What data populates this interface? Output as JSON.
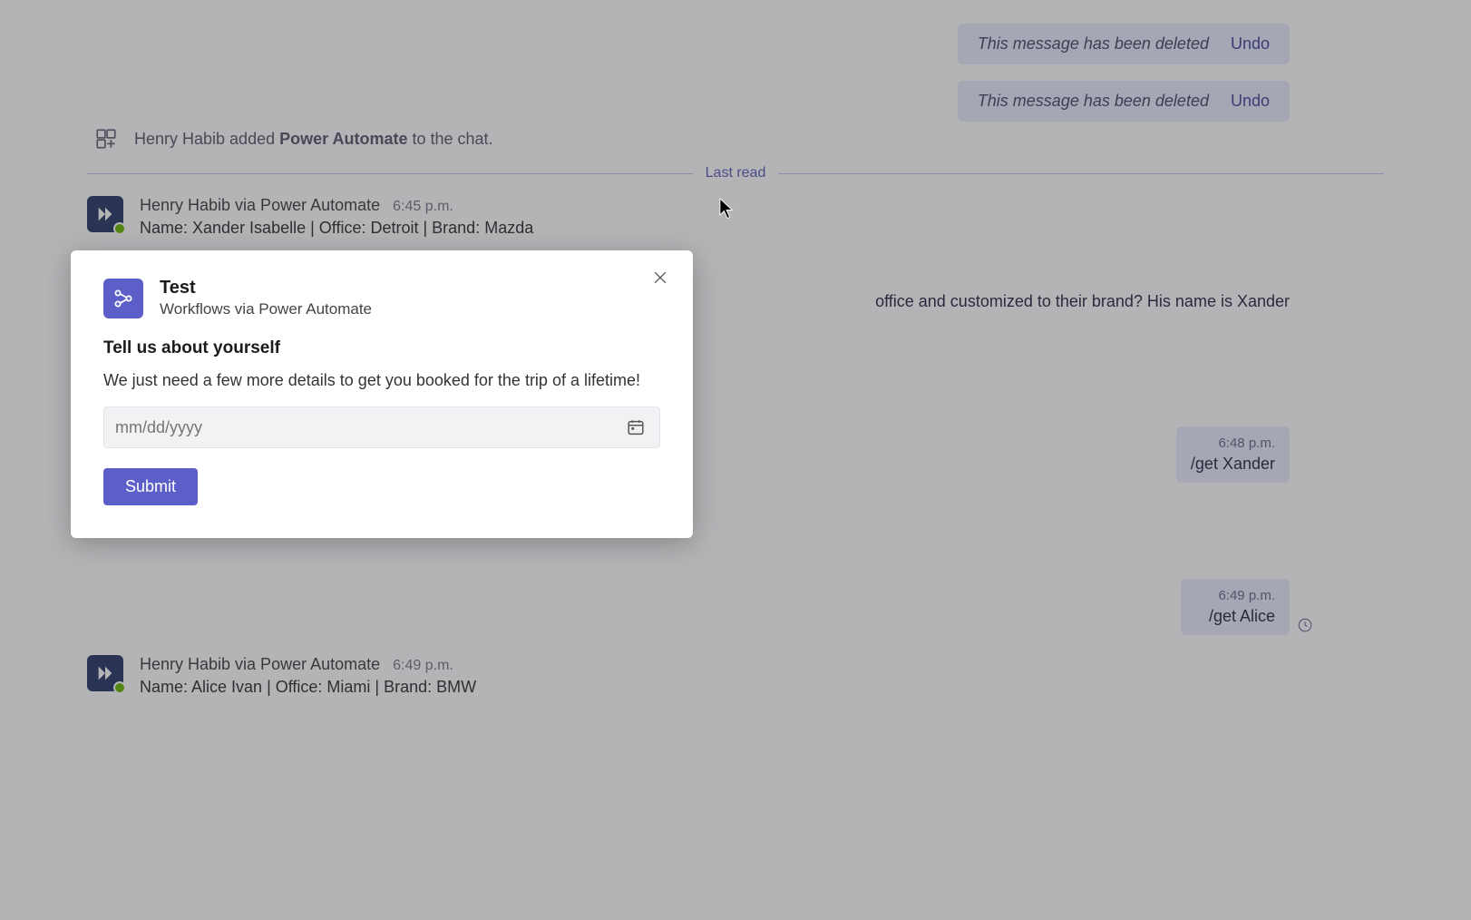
{
  "deleted": {
    "text": "This message has been deleted",
    "undo": "Undo"
  },
  "system": {
    "prefix": "Henry Habib added ",
    "app": "Power Automate",
    "suffix": " to the chat."
  },
  "divider_label": "Last read",
  "messages": {
    "m1": {
      "sender": "Henry Habib via Power Automate",
      "time": "6:45 p.m.",
      "content": "Name: Xander Isabelle | Office: Detroit | Brand: Mazda"
    },
    "m_partial": {
      "content_fragment": "office and customized to their brand? His name is Xander"
    },
    "r1": {
      "time": "6:48 p.m.",
      "content": "/get Xander"
    },
    "m2": {
      "content": "Name: Xander Isabelle | Office: Detroit | Brand: Mazda"
    },
    "r2": {
      "time": "6:49 p.m.",
      "content": "/get Alice"
    },
    "m3": {
      "sender": "Henry Habib via Power Automate",
      "time": "6:49 p.m.",
      "content": "Name: Alice Ivan | Office: Miami | Brand: BMW"
    }
  },
  "modal": {
    "title": "Test",
    "subtitle": "Workflows via Power Automate",
    "heading": "Tell us about yourself",
    "description": "We just need a few more details to get you booked for the trip of a lifetime!",
    "date_placeholder": "mm/dd/yyyy",
    "submit_label": "Submit"
  }
}
